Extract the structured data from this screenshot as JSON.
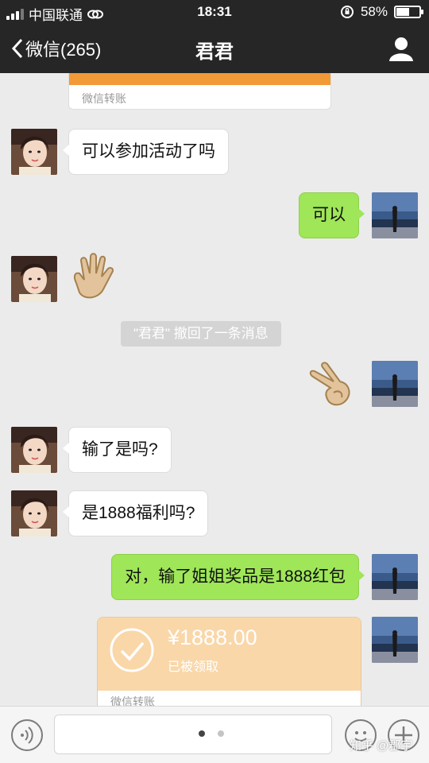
{
  "status_bar": {
    "carrier": "中国联通",
    "time": "18:31",
    "battery": "58%",
    "battery_level": 0.58
  },
  "header": {
    "back_label": "微信(265)",
    "title": "君君"
  },
  "chat": {
    "transfer_top_label": "微信转账",
    "messages": [
      {
        "side": "in",
        "text": "可以参加活动了吗"
      },
      {
        "side": "out",
        "text": "可以"
      },
      {
        "side": "in",
        "type": "emoji",
        "emoji": "open-hand"
      },
      {
        "side": "system",
        "text": "\"君君\" 撤回了一条消息"
      },
      {
        "side": "out",
        "type": "emoji",
        "emoji": "victory-hand"
      },
      {
        "side": "in",
        "text": "输了是吗?"
      },
      {
        "side": "in",
        "text": "是1888福利吗?"
      },
      {
        "side": "out",
        "text": "对，输了姐姐奖品是1888红包"
      }
    ],
    "transfer": {
      "amount": "¥1888.00",
      "status": "已被领取",
      "label": "微信转账"
    }
  },
  "bottom": {
    "watermark": "知乎 @郡宇"
  },
  "colors": {
    "header_bg": "#262626",
    "chat_bg": "#ebebeb",
    "out_bubble": "#9fe658",
    "transfer_card": "#f9d7a9",
    "transfer_stripe": "#f29a38"
  }
}
